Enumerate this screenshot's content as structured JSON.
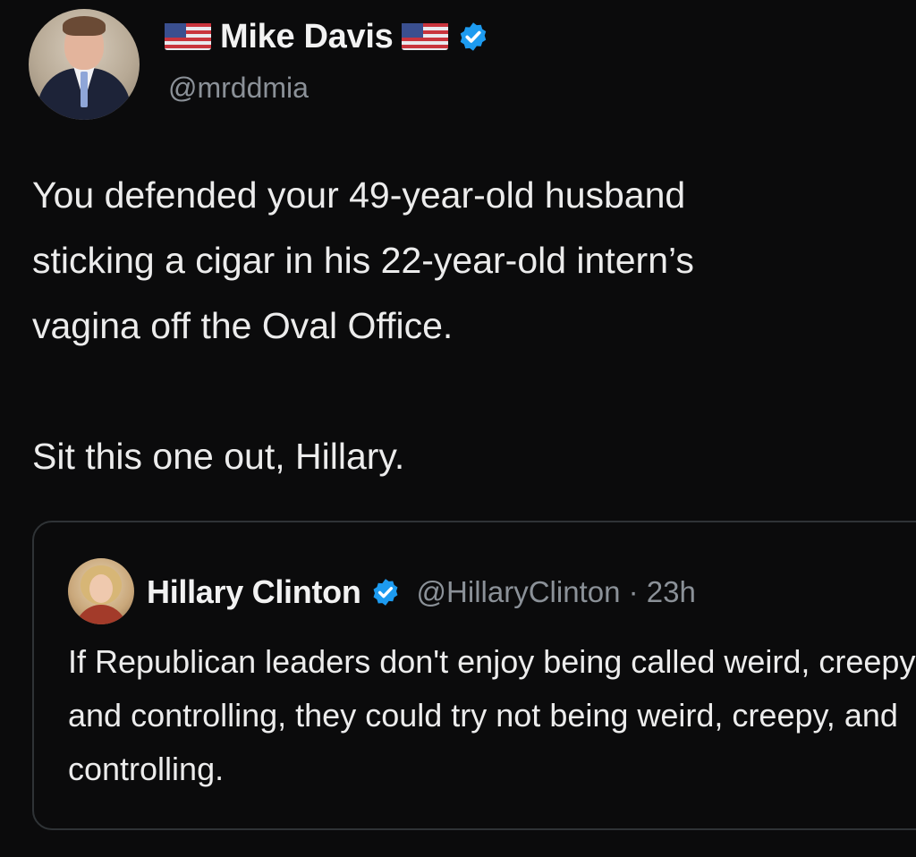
{
  "post": {
    "author": {
      "display_name": "Mike Davis",
      "handle": "@mrddmia",
      "flag_icon": "us-flag-icon",
      "verified": true
    },
    "text_paragraphs": [
      "You defended your 49-year-old husband\nsticking a cigar in his 22-year-old intern’s\nvagina off the Oval Office.",
      "Sit this one out, Hillary."
    ]
  },
  "quoted_post": {
    "author": {
      "display_name": "Hillary Clinton",
      "handle_time": "@HillaryClinton · 23h",
      "verified": true
    },
    "text": "If Republican leaders don't enjoy being called weird, creepy, and controlling, they could try not being weird, creepy, and controlling."
  },
  "colors": {
    "background": "#0b0b0c",
    "text": "#ececec",
    "secondary_text": "#8b9198",
    "verified_blue": "#1d9bf0",
    "quote_border": "#2f3336"
  }
}
